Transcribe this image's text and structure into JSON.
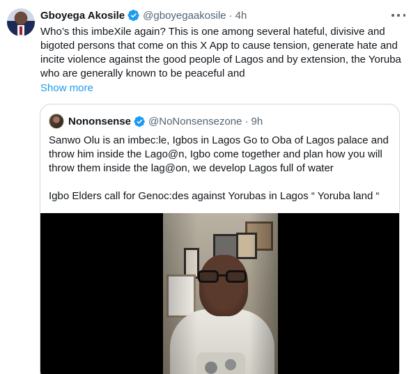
{
  "tweet": {
    "author_name": "Gboyega Akosile",
    "author_handle": "@gboyegaakosile",
    "separator": "·",
    "time": "4h",
    "text": "Who’s this imbeXile again? This is one among several hateful, divisive and bigoted persons that come on this X App to cause tension, generate hate and incite violence against the good people of Lagos and by extension, the Yoruba who are generally known to be peaceful and",
    "show_more_label": "Show more"
  },
  "quote": {
    "author_name": "Nononsense",
    "author_handle": "@NoNonsensezone",
    "separator": "·",
    "time": "9h",
    "paragraph_1": "Sanwo Olu is an imbec:le, Igbos in Lagos Go to Oba of Lagos palace and throw him inside the Lago@n, Igbo come together and plan how you will throw them inside the lag@on, we develop Lagos full of water",
    "paragraph_2": "Igbo Elders call for Genoc:des against Yorubas in Lagos “ Yoruba land “"
  },
  "icons": {
    "verified": "verified-badge-icon",
    "more": "more-horizontal-icon"
  },
  "colors": {
    "link": "#1d9bf0",
    "secondary_text": "#536471",
    "border": "#cfd9de"
  }
}
